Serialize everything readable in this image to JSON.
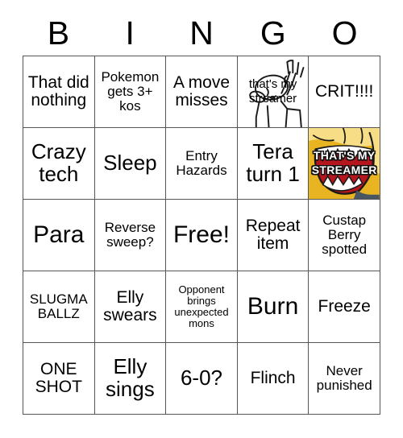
{
  "header": {
    "letters": [
      "B",
      "I",
      "N",
      "G",
      "O"
    ]
  },
  "colors": {
    "grid_line": "#555555",
    "background": "#ffffff",
    "text": "#000000",
    "creature_body": "#e8b422",
    "creature_highlight": "#f7dd86",
    "creature_mouth": "#b5161d",
    "creature_teeth": "#ffffff",
    "creature_outline": "#1a1a1a",
    "caption_fill": "#ffffff",
    "caption_stroke": "#111111"
  },
  "grid": {
    "rows": [
      [
        {
          "id": "b1",
          "text": "That did nothing",
          "size": "fs-md",
          "type": "text"
        },
        {
          "id": "i1",
          "text": "Pokemon gets 3+ kos",
          "size": "fs-sm",
          "type": "text"
        },
        {
          "id": "n1",
          "text": "A move misses",
          "size": "fs-md",
          "type": "text"
        },
        {
          "id": "g1",
          "text": "that's my streamer",
          "size": "fs-sm",
          "type": "image-lineart",
          "icon": "pointing-person-meme-icon"
        },
        {
          "id": "o1",
          "text": "CRIT!!!!",
          "size": "fs-md",
          "type": "text"
        }
      ],
      [
        {
          "id": "b2",
          "text": "Crazy tech",
          "size": "fs-lg",
          "type": "text"
        },
        {
          "id": "i2",
          "text": "Sleep",
          "size": "fs-lg",
          "type": "text"
        },
        {
          "id": "n2",
          "text": "Entry Hazards",
          "size": "fs-sm",
          "type": "text"
        },
        {
          "id": "g2",
          "text": "Tera turn 1",
          "size": "fs-lg",
          "type": "text"
        },
        {
          "id": "o2",
          "text": "THAT'S MY STREAMER",
          "size": "fs-xs",
          "type": "image-creature",
          "icon": "roaring-creature-photo-icon"
        }
      ],
      [
        {
          "id": "b3",
          "text": "Para",
          "size": "fs-xl",
          "type": "text"
        },
        {
          "id": "i3",
          "text": "Reverse sweep?",
          "size": "fs-sm",
          "type": "text"
        },
        {
          "id": "n3",
          "text": "Free!",
          "size": "fs-xl",
          "type": "text"
        },
        {
          "id": "g3",
          "text": "Repeat item",
          "size": "fs-md",
          "type": "text"
        },
        {
          "id": "o3",
          "text": "Custap Berry spotted",
          "size": "fs-sm",
          "type": "text"
        }
      ],
      [
        {
          "id": "b4",
          "text": "SLUGMA BALLZ",
          "size": "fs-sm",
          "type": "text"
        },
        {
          "id": "i4",
          "text": "Elly swears",
          "size": "fs-md",
          "type": "text"
        },
        {
          "id": "n4",
          "text": "Opponent brings unexpected mons",
          "size": "fs-xs",
          "type": "text"
        },
        {
          "id": "g4",
          "text": "Burn",
          "size": "fs-xl",
          "type": "text"
        },
        {
          "id": "o4",
          "text": "Freeze",
          "size": "fs-md",
          "type": "text"
        }
      ],
      [
        {
          "id": "b5",
          "text": "ONE SHOT",
          "size": "fs-md",
          "type": "text"
        },
        {
          "id": "i5",
          "text": "Elly sings",
          "size": "fs-lg",
          "type": "text"
        },
        {
          "id": "n5",
          "text": "6-0?",
          "size": "fs-lg",
          "type": "text"
        },
        {
          "id": "g5",
          "text": "Flinch",
          "size": "fs-md",
          "type": "text"
        },
        {
          "id": "o5",
          "text": "Never punished",
          "size": "fs-sm",
          "type": "text"
        }
      ]
    ]
  }
}
